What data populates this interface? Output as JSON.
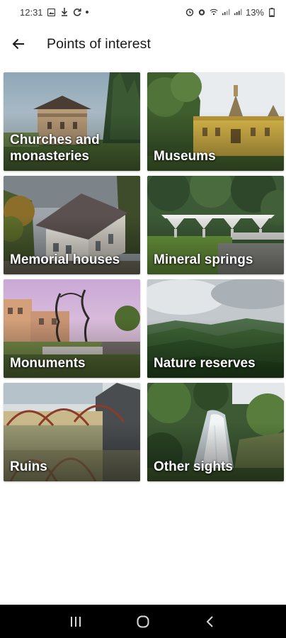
{
  "status_bar": {
    "time": "12:31",
    "battery": "13%"
  },
  "app_bar": {
    "title": "Points of interest",
    "back_icon": "arrow-left-icon"
  },
  "categories": [
    {
      "label": "Churches and monasteries"
    },
    {
      "label": "Museums"
    },
    {
      "label": "Memorial houses"
    },
    {
      "label": "Mineral springs"
    },
    {
      "label": "Monuments"
    },
    {
      "label": "Nature reserves"
    },
    {
      "label": "Ruins"
    },
    {
      "label": "Other sights"
    }
  ],
  "nav_bar": {
    "icons": [
      "recent-apps-icon",
      "home-icon",
      "back-icon"
    ]
  },
  "colors": {
    "background": "#ffffff",
    "title_text": "#1a1a1a",
    "label_text": "#ffffff",
    "nav_bar": "#000000"
  }
}
